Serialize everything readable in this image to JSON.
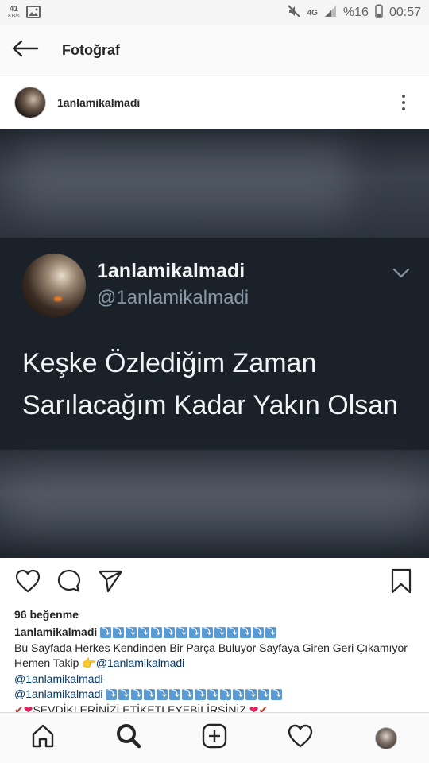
{
  "status_bar": {
    "speed": "41",
    "speed_unit": "KB/s",
    "network": "4G",
    "battery": "%16",
    "time": "00:57"
  },
  "header": {
    "title": "Fotoğraf"
  },
  "post": {
    "username": "1anlamikalmadi",
    "likes": "96 beğenme"
  },
  "tweet": {
    "name": "1anlamikalmadi",
    "handle": "@1anlamikalmadi",
    "text_line1": "Keşke Özlediğim Zaman",
    "text_line2": "Sarılacağım Kadar Yakın Olsan"
  },
  "caption": {
    "user": "1anlamikalmadi",
    "line2": "Bu Sayfada Herkes Kendinden Bir Parça Buluyor Sayfaya Giren Geri Çıkamıyor",
    "line3_prefix": "Hemen Takip 👉",
    "mention1": "@1anlamikalmadi",
    "mention2": "@1anlamikalmadi",
    "mention3": "@1anlamikalmadi",
    "line6": "SEVDİKLERİNİZİ ETİKETLEYEBİLİRSİNİZ"
  },
  "icons": {
    "back": "arrow-left-icon",
    "more": "more-vertical-icon",
    "like": "heart-icon",
    "comment": "comment-icon",
    "share": "send-icon",
    "save": "bookmark-icon",
    "home": "home-icon",
    "search": "search-icon",
    "add": "add-post-icon",
    "activity": "heart-icon",
    "profile": "avatar"
  },
  "colors": {
    "tweet_bg": "#1a2129",
    "tweet_text": "#f1f3f5",
    "handle": "#8899a6",
    "mention": "#003569",
    "badge": "#5a9bd5"
  }
}
